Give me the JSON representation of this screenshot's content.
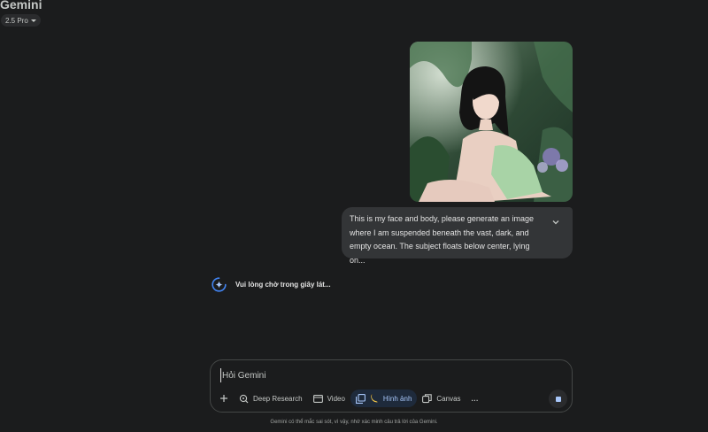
{
  "header": {
    "app_title": "Gemini",
    "model_label": "2.5 Pro"
  },
  "conversation": {
    "user_image_alt": "",
    "user_message": "This is my face and body, please generate an image where I am suspended beneath the vast, dark, and empty ocean. The subject floats below center, lying on...",
    "loading_text": "Vui lòng chờ trong giây lát..."
  },
  "composer": {
    "placeholder": "Hỏi Gemini",
    "tools": {
      "deep_research": "Deep Research",
      "video": "Video",
      "image": "Hình ảnh",
      "canvas": "Canvas",
      "more": "..."
    }
  },
  "footer": {
    "disclaimer": "Gemini có thể mắc sai sót, vì vậy, nhớ xác minh câu trả lời của Gemini."
  },
  "colors": {
    "background": "#1b1c1d",
    "bubble": "#333537",
    "accent": "#a8c7fa",
    "loader": "#4285f4"
  },
  "icons": {
    "model_caret": "caret-down-icon",
    "expand": "chevron-down-icon",
    "loader": "gemini-spark-icon",
    "add": "plus-icon",
    "deep_research": "deep-research-icon",
    "video": "video-icon",
    "image": "image-icon",
    "banana": "banana-icon",
    "canvas": "canvas-icon",
    "more": "more-icon",
    "stop": "stop-icon"
  }
}
